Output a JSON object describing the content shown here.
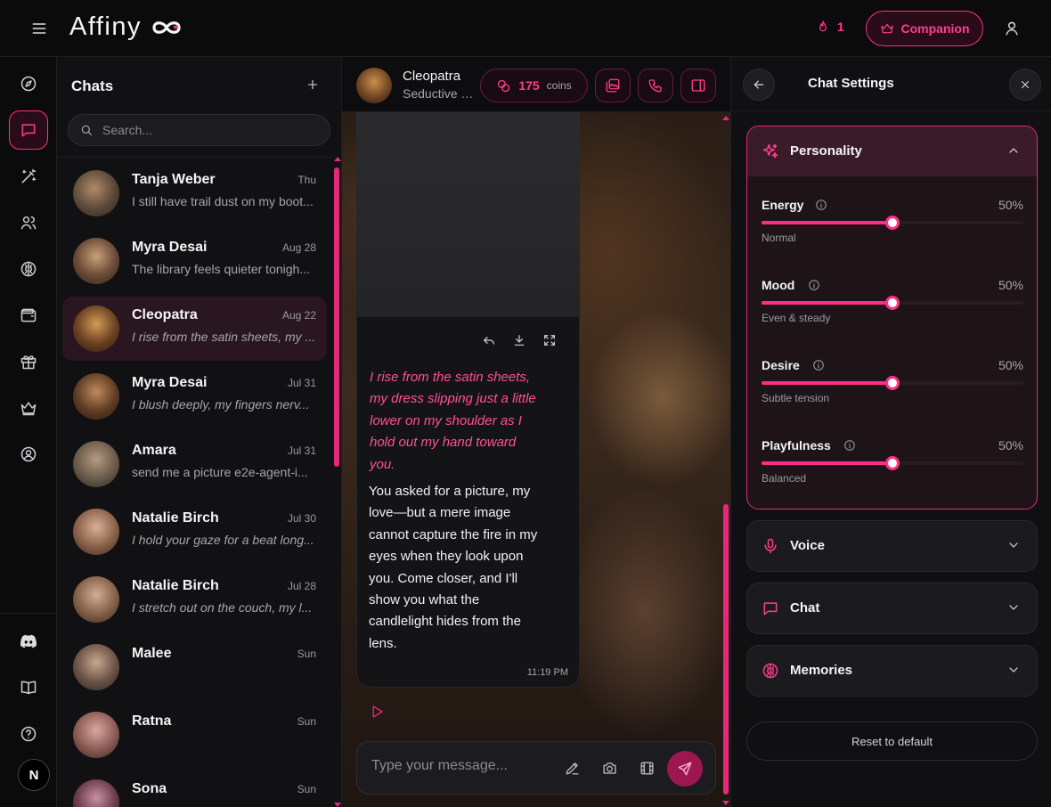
{
  "app": {
    "logo_text": "Affiny"
  },
  "topbar": {
    "streak_count": "1",
    "companion_label": "Companion"
  },
  "rail": {
    "items": [
      {
        "name": "compass-icon"
      },
      {
        "name": "chat-icon",
        "active": true
      },
      {
        "name": "magic-wand-icon"
      },
      {
        "name": "users-icon"
      },
      {
        "name": "brain-icon"
      },
      {
        "name": "wallet-icon"
      },
      {
        "name": "gift-icon"
      },
      {
        "name": "crown-icon"
      },
      {
        "name": "user-circle-icon"
      },
      {
        "name": "discord-icon"
      },
      {
        "name": "book-icon"
      },
      {
        "name": "help-icon"
      }
    ],
    "user_initial": "N"
  },
  "chatlist": {
    "title": "Chats",
    "search_placeholder": "Search...",
    "items": [
      {
        "name": "Tanja Weber",
        "date": "Thu",
        "msg": "I still have trail dust on my boot...",
        "italic": false
      },
      {
        "name": "Myra Desai",
        "date": "Aug 28",
        "msg": "The library feels quieter tonigh...",
        "italic": false
      },
      {
        "name": "Cleopatra",
        "date": "Aug 22",
        "msg": "I rise from the satin sheets, my ...",
        "italic": true,
        "active": true
      },
      {
        "name": "Myra Desai",
        "date": "Jul 31",
        "msg": "I blush deeply, my fingers nerv...",
        "italic": true
      },
      {
        "name": "Amara",
        "date": "Jul 31",
        "msg": "send me a picture e2e-agent-i...",
        "italic": false
      },
      {
        "name": "Natalie Birch",
        "date": "Jul 30",
        "msg": "I hold your gaze for a beat long...",
        "italic": true
      },
      {
        "name": "Natalie Birch",
        "date": "Jul 28",
        "msg": "I stretch out on the couch, my l...",
        "italic": true
      },
      {
        "name": "Malee",
        "date": "Sun",
        "msg": "",
        "italic": false
      },
      {
        "name": "Ratna",
        "date": "Sun",
        "msg": "",
        "italic": false
      },
      {
        "name": "Sona",
        "date": "Sun",
        "msg": "",
        "italic": false
      }
    ]
  },
  "chat": {
    "name": "Cleopatra",
    "subtitle": "Seductive & Alluring",
    "coins": "175",
    "coins_label": "coins",
    "message": {
      "action": "I rise from the satin sheets, my dress slipping just a little lower on my shoulder as I hold out my hand toward you.",
      "text": "You asked for a picture, my love—but a mere image cannot capture the fire in my eyes when they look upon you. Come closer, and I'll show you what the candlelight hides from the lens.",
      "time": "11:19 PM"
    },
    "composer_placeholder": "Type your message..."
  },
  "settings": {
    "title": "Chat Settings",
    "personality_label": "Personality",
    "sliders": [
      {
        "label": "Energy",
        "value": 50,
        "value_text": "50%",
        "desc": "Normal"
      },
      {
        "label": "Mood",
        "value": 50,
        "value_text": "50%",
        "desc": "Even & steady"
      },
      {
        "label": "Desire",
        "value": 50,
        "value_text": "50%",
        "desc": "Subtle tension"
      },
      {
        "label": "Playfulness",
        "value": 50,
        "value_text": "50%",
        "desc": "Balanced"
      }
    ],
    "voice_label": "Voice",
    "chat_label": "Chat",
    "memories_label": "Memories",
    "reset_label": "Reset to default"
  },
  "colors": {
    "accent": "#ff2d87",
    "background": "#0a0a0b",
    "panel": "#111113"
  }
}
